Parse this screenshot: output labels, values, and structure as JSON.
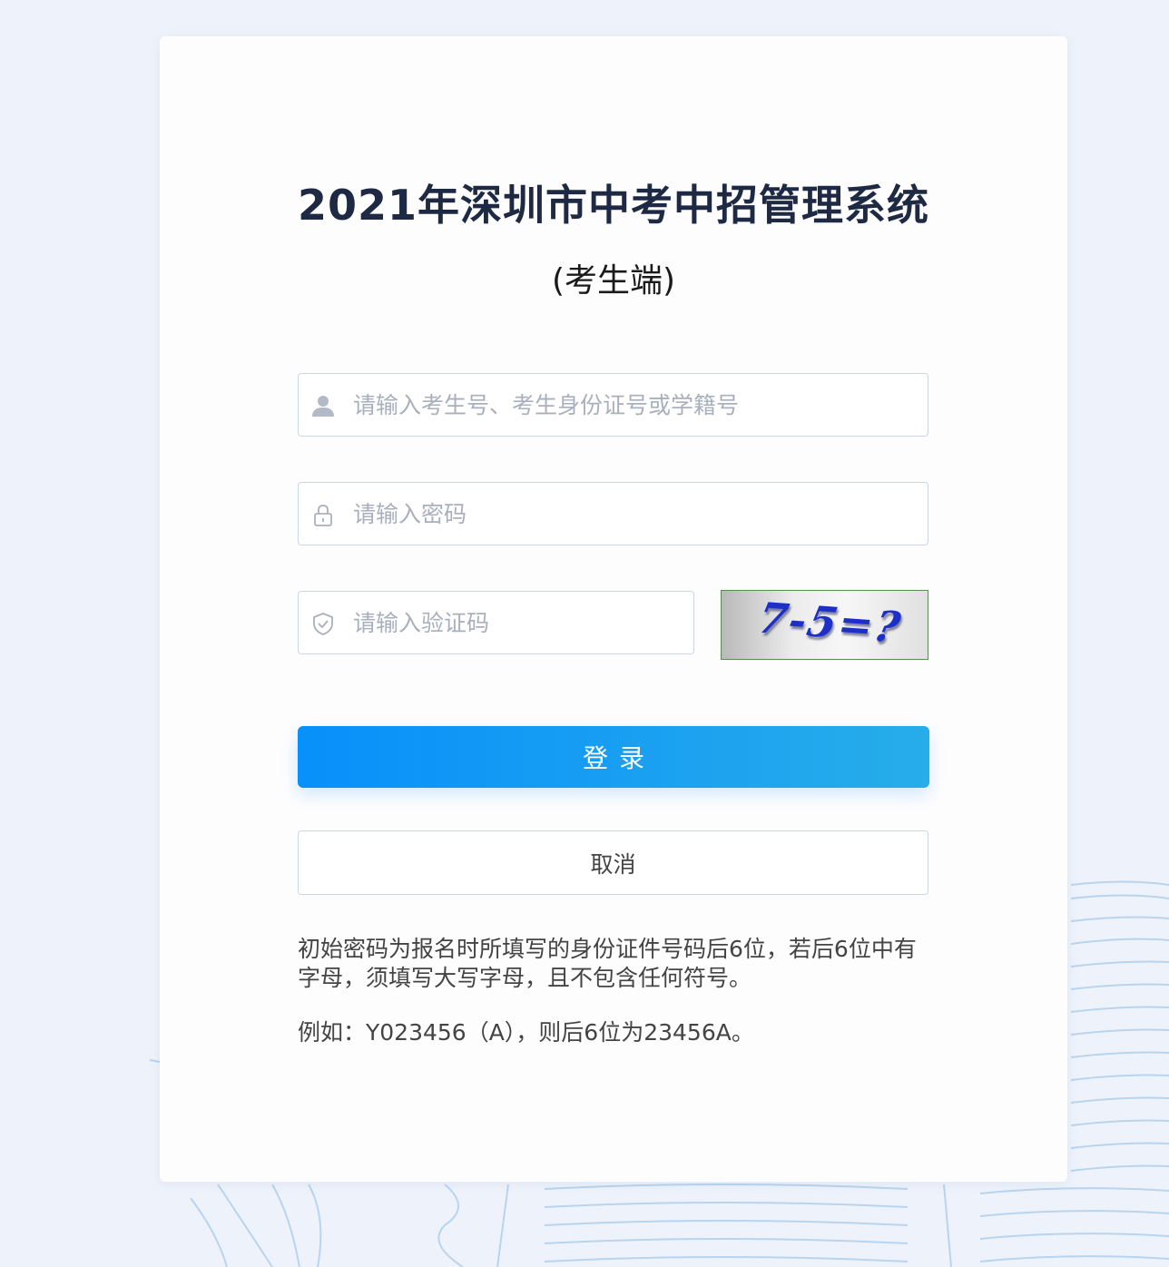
{
  "header": {
    "title": "2021年深圳市中考中招管理系统",
    "subtitle": "(考生端)"
  },
  "form": {
    "username": {
      "icon": "user-icon",
      "placeholder": "请输入考生号、考生身份证号或学籍号",
      "value": ""
    },
    "password": {
      "icon": "lock-icon",
      "placeholder": "请输入密码",
      "value": ""
    },
    "captcha": {
      "icon": "shield-check-icon",
      "placeholder": "请输入验证码",
      "value": "",
      "image_text": "7-5=?"
    },
    "login_label": "登录",
    "cancel_label": "取消"
  },
  "notes": {
    "rule": "初始密码为报名时所填写的身份证件号码后6位，若后6位中有字母，须填写大写字母，且不包含任何符号。",
    "example": "例如：Y023456（A），则后6位为23456A。"
  },
  "colors": {
    "primary_gradient_start": "#0890fb",
    "primary_gradient_end": "#27ade9",
    "title": "#1e2a44",
    "captcha_text": "#1c2fc8"
  }
}
